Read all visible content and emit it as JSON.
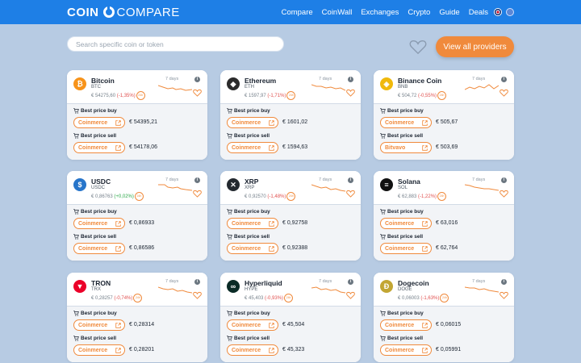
{
  "header": {
    "logo_left": "COIN",
    "logo_right": "COMPARE",
    "nav": [
      "Compare",
      "CoinWall",
      "Exchanges",
      "Crypto",
      "Guide",
      "Deals"
    ]
  },
  "search": {
    "placeholder": "Search specific coin or token"
  },
  "providers_button": "View all providers",
  "labels": {
    "days": "7 days",
    "best_buy": "Best price buy",
    "best_sell": "Best price sell",
    "badge": "24h"
  },
  "colors": {
    "accent": "#f08a3c",
    "brand": "#1e7fe6",
    "down": "#e0504f",
    "up": "#2ea84a"
  },
  "cards": [
    {
      "name": "Bitcoin",
      "symbol": "BTC",
      "price": "€ 54275,60",
      "change": "(-1,35%)",
      "up": false,
      "icon": "bitcoin-icon",
      "color": "#f7931a",
      "glyph": "₿",
      "buy_provider": "Coinmerce",
      "buy_price": "€ 54395,21",
      "sell_provider": "Coinmerce",
      "sell_price": "€ 54178,06"
    },
    {
      "name": "Ethereum",
      "symbol": "ETH",
      "price": "€ 1597,97",
      "change": "(-1,71%)",
      "up": false,
      "icon": "ethereum-icon",
      "color": "#2b2b2b",
      "glyph": "◆",
      "buy_provider": "Coinmerce",
      "buy_price": "€ 1601,02",
      "sell_provider": "Coinmerce",
      "sell_price": "€ 1594,63"
    },
    {
      "name": "Binance Coin",
      "symbol": "BNB",
      "price": "€ 504,72",
      "change": "(-0,55%)",
      "up": false,
      "icon": "binance-icon",
      "color": "#f0b90b",
      "glyph": "◈",
      "buy_provider": "Coinmerce",
      "buy_price": "€ 505,67",
      "sell_provider": "Bitvavo",
      "sell_price": "€ 503,69"
    },
    {
      "name": "USDC",
      "symbol": "USDC",
      "price": "€ 0,86763",
      "change": "(+0,02%)",
      "up": true,
      "icon": "usdc-icon",
      "color": "#2775ca",
      "glyph": "$",
      "buy_provider": "Coinmerce",
      "buy_price": "€ 0,86933",
      "sell_provider": "Coinmerce",
      "sell_price": "€ 0,86586"
    },
    {
      "name": "XRP",
      "symbol": "XRP",
      "price": "€ 0,92570",
      "change": "(-1,48%)",
      "up": false,
      "icon": "xrp-icon",
      "color": "#23292f",
      "glyph": "✕",
      "buy_provider": "Coinmerce",
      "buy_price": "€ 0,92758",
      "sell_provider": "Coinmerce",
      "sell_price": "€ 0,92388"
    },
    {
      "name": "Solana",
      "symbol": "SOL",
      "price": "€ 62,883",
      "change": "(-1,22%)",
      "up": false,
      "icon": "solana-icon",
      "color": "#111111",
      "glyph": "≡",
      "buy_provider": "Coinmerce",
      "buy_price": "€ 63,016",
      "sell_provider": "Coinmerce",
      "sell_price": "€ 62,764"
    },
    {
      "name": "TRON",
      "symbol": "TRX",
      "price": "€ 0,28257",
      "change": "(-0,74%)",
      "up": false,
      "icon": "tron-icon",
      "color": "#eb0029",
      "glyph": "▼",
      "buy_provider": "Coinmerce",
      "buy_price": "€ 0,28314",
      "sell_provider": "Coinmerce",
      "sell_price": "€ 0,28201"
    },
    {
      "name": "Hyperliquid",
      "symbol": "HYPE",
      "price": "€ 45,403",
      "change": "(-0,93%)",
      "up": false,
      "icon": "hyperliquid-icon",
      "color": "#0a2b26",
      "glyph": "∞",
      "buy_provider": "Coinmerce",
      "buy_price": "€ 45,504",
      "sell_provider": "Coinmerce",
      "sell_price": "€ 45,323"
    },
    {
      "name": "Dogecoin",
      "symbol": "DOGE",
      "price": "€ 0,06003",
      "change": "(-1,63%)",
      "up": false,
      "icon": "dogecoin-icon",
      "color": "#c2a633",
      "glyph": "Ð",
      "buy_provider": "Coinmerce",
      "buy_price": "€ 0,06015",
      "sell_provider": "Coinmerce",
      "sell_price": "€ 0,05991"
    }
  ]
}
